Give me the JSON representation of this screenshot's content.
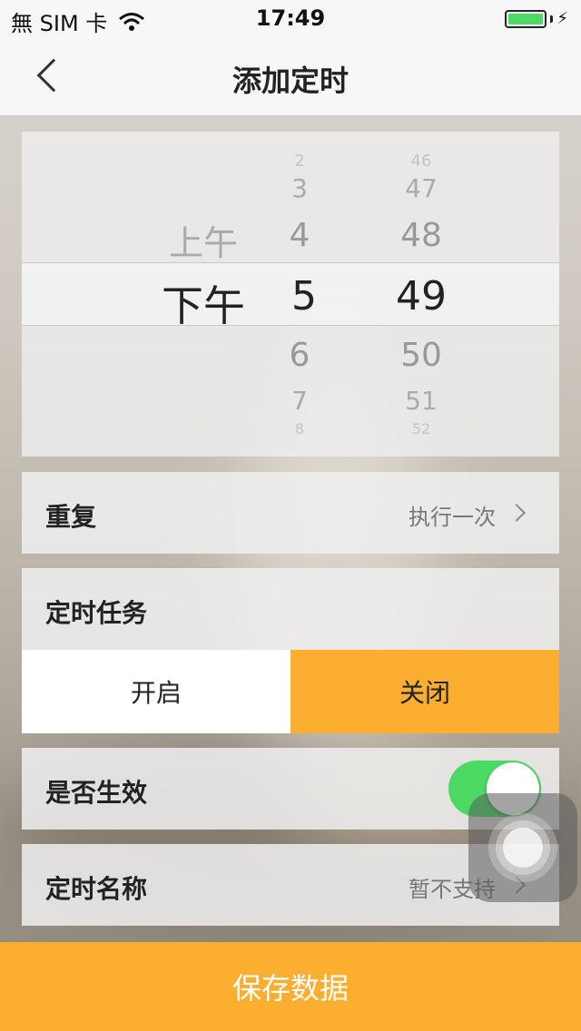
{
  "status": {
    "carrier": "無 SIM 卡",
    "time": "17:49"
  },
  "nav": {
    "title": "添加定时"
  },
  "picker": {
    "period": {
      "items": [
        "上午",
        "下午"
      ],
      "selected": "下午"
    },
    "hour": {
      "items": [
        "2",
        "3",
        "4",
        "5",
        "6",
        "7",
        "8"
      ],
      "selected": "5"
    },
    "minute": {
      "items": [
        "46",
        "47",
        "48",
        "49",
        "50",
        "51",
        "52"
      ],
      "selected": "49"
    }
  },
  "repeat": {
    "label": "重复",
    "value": "执行一次"
  },
  "task": {
    "label": "定时任务",
    "on_label": "开启",
    "off_label": "关闭",
    "selected": "关闭"
  },
  "effective": {
    "label": "是否生效",
    "enabled": true
  },
  "name": {
    "label": "定时名称",
    "value": "暂不支持"
  },
  "save_label": "保存数据",
  "colors": {
    "accent": "#fbae30",
    "toggle_on": "#4cd964"
  }
}
